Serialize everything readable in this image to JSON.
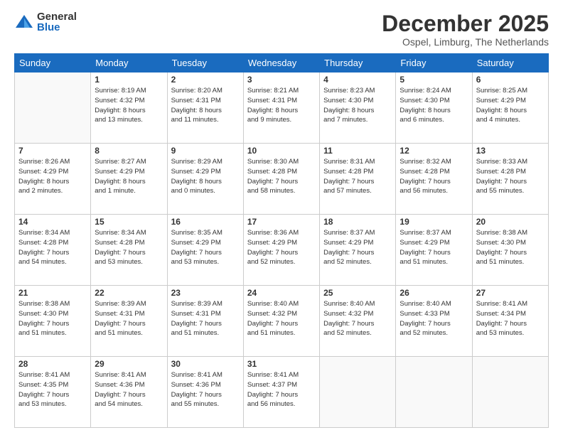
{
  "logo": {
    "general": "General",
    "blue": "Blue"
  },
  "title": {
    "month": "December 2025",
    "location": "Ospel, Limburg, The Netherlands"
  },
  "headers": [
    "Sunday",
    "Monday",
    "Tuesday",
    "Wednesday",
    "Thursday",
    "Friday",
    "Saturday"
  ],
  "weeks": [
    [
      {
        "day": "",
        "info": ""
      },
      {
        "day": "1",
        "info": "Sunrise: 8:19 AM\nSunset: 4:32 PM\nDaylight: 8 hours\nand 13 minutes."
      },
      {
        "day": "2",
        "info": "Sunrise: 8:20 AM\nSunset: 4:31 PM\nDaylight: 8 hours\nand 11 minutes."
      },
      {
        "day": "3",
        "info": "Sunrise: 8:21 AM\nSunset: 4:31 PM\nDaylight: 8 hours\nand 9 minutes."
      },
      {
        "day": "4",
        "info": "Sunrise: 8:23 AM\nSunset: 4:30 PM\nDaylight: 8 hours\nand 7 minutes."
      },
      {
        "day": "5",
        "info": "Sunrise: 8:24 AM\nSunset: 4:30 PM\nDaylight: 8 hours\nand 6 minutes."
      },
      {
        "day": "6",
        "info": "Sunrise: 8:25 AM\nSunset: 4:29 PM\nDaylight: 8 hours\nand 4 minutes."
      }
    ],
    [
      {
        "day": "7",
        "info": "Sunrise: 8:26 AM\nSunset: 4:29 PM\nDaylight: 8 hours\nand 2 minutes."
      },
      {
        "day": "8",
        "info": "Sunrise: 8:27 AM\nSunset: 4:29 PM\nDaylight: 8 hours\nand 1 minute."
      },
      {
        "day": "9",
        "info": "Sunrise: 8:29 AM\nSunset: 4:29 PM\nDaylight: 8 hours\nand 0 minutes."
      },
      {
        "day": "10",
        "info": "Sunrise: 8:30 AM\nSunset: 4:28 PM\nDaylight: 7 hours\nand 58 minutes."
      },
      {
        "day": "11",
        "info": "Sunrise: 8:31 AM\nSunset: 4:28 PM\nDaylight: 7 hours\nand 57 minutes."
      },
      {
        "day": "12",
        "info": "Sunrise: 8:32 AM\nSunset: 4:28 PM\nDaylight: 7 hours\nand 56 minutes."
      },
      {
        "day": "13",
        "info": "Sunrise: 8:33 AM\nSunset: 4:28 PM\nDaylight: 7 hours\nand 55 minutes."
      }
    ],
    [
      {
        "day": "14",
        "info": "Sunrise: 8:34 AM\nSunset: 4:28 PM\nDaylight: 7 hours\nand 54 minutes."
      },
      {
        "day": "15",
        "info": "Sunrise: 8:34 AM\nSunset: 4:28 PM\nDaylight: 7 hours\nand 53 minutes."
      },
      {
        "day": "16",
        "info": "Sunrise: 8:35 AM\nSunset: 4:29 PM\nDaylight: 7 hours\nand 53 minutes."
      },
      {
        "day": "17",
        "info": "Sunrise: 8:36 AM\nSunset: 4:29 PM\nDaylight: 7 hours\nand 52 minutes."
      },
      {
        "day": "18",
        "info": "Sunrise: 8:37 AM\nSunset: 4:29 PM\nDaylight: 7 hours\nand 52 minutes."
      },
      {
        "day": "19",
        "info": "Sunrise: 8:37 AM\nSunset: 4:29 PM\nDaylight: 7 hours\nand 51 minutes."
      },
      {
        "day": "20",
        "info": "Sunrise: 8:38 AM\nSunset: 4:30 PM\nDaylight: 7 hours\nand 51 minutes."
      }
    ],
    [
      {
        "day": "21",
        "info": "Sunrise: 8:38 AM\nSunset: 4:30 PM\nDaylight: 7 hours\nand 51 minutes."
      },
      {
        "day": "22",
        "info": "Sunrise: 8:39 AM\nSunset: 4:31 PM\nDaylight: 7 hours\nand 51 minutes."
      },
      {
        "day": "23",
        "info": "Sunrise: 8:39 AM\nSunset: 4:31 PM\nDaylight: 7 hours\nand 51 minutes."
      },
      {
        "day": "24",
        "info": "Sunrise: 8:40 AM\nSunset: 4:32 PM\nDaylight: 7 hours\nand 51 minutes."
      },
      {
        "day": "25",
        "info": "Sunrise: 8:40 AM\nSunset: 4:32 PM\nDaylight: 7 hours\nand 52 minutes."
      },
      {
        "day": "26",
        "info": "Sunrise: 8:40 AM\nSunset: 4:33 PM\nDaylight: 7 hours\nand 52 minutes."
      },
      {
        "day": "27",
        "info": "Sunrise: 8:41 AM\nSunset: 4:34 PM\nDaylight: 7 hours\nand 53 minutes."
      }
    ],
    [
      {
        "day": "28",
        "info": "Sunrise: 8:41 AM\nSunset: 4:35 PM\nDaylight: 7 hours\nand 53 minutes."
      },
      {
        "day": "29",
        "info": "Sunrise: 8:41 AM\nSunset: 4:36 PM\nDaylight: 7 hours\nand 54 minutes."
      },
      {
        "day": "30",
        "info": "Sunrise: 8:41 AM\nSunset: 4:36 PM\nDaylight: 7 hours\nand 55 minutes."
      },
      {
        "day": "31",
        "info": "Sunrise: 8:41 AM\nSunset: 4:37 PM\nDaylight: 7 hours\nand 56 minutes."
      },
      {
        "day": "",
        "info": ""
      },
      {
        "day": "",
        "info": ""
      },
      {
        "day": "",
        "info": ""
      }
    ]
  ]
}
